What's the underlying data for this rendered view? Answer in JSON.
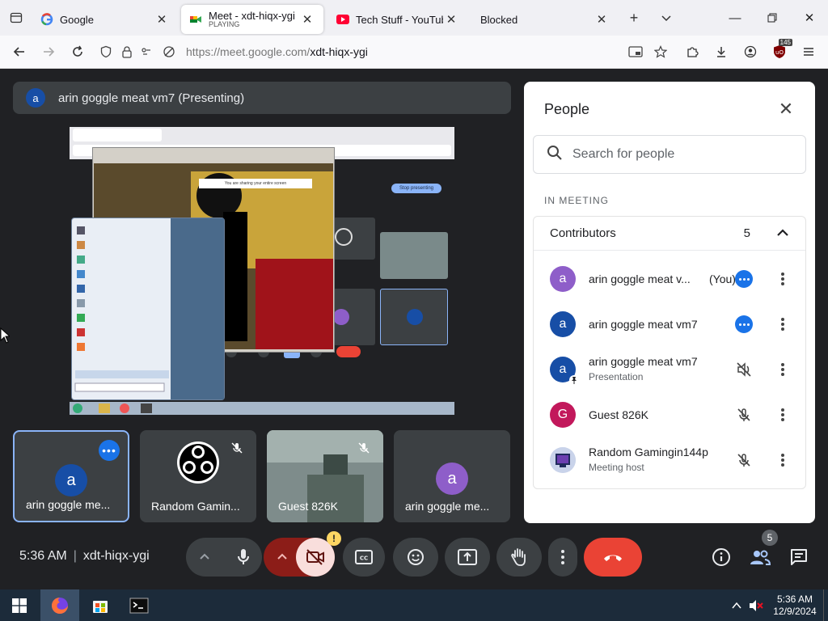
{
  "browser": {
    "tabs": [
      {
        "title": "Google",
        "subtitle": ""
      },
      {
        "title": "Meet - xdt-hiqx-ygi",
        "subtitle": "PLAYING"
      },
      {
        "title": "Tech Stuff - YouTube",
        "subtitle": ""
      },
      {
        "title": "Blocked",
        "subtitle": ""
      }
    ],
    "url_host": "https://meet.google.com/",
    "url_path": "xdt-hiqx-ygi",
    "extension_badge": "145"
  },
  "meet": {
    "presenting_avatar": "a",
    "presenting_label": "arin goggle meat vm7 (Presenting)",
    "tiles": [
      {
        "name": "arin goggle me...",
        "avatar": "a",
        "avatar_color": "#174ea6"
      },
      {
        "name": "Random Gamin...",
        "avatar": "",
        "avatar_color": "#000000"
      },
      {
        "name": "Guest 826K",
        "avatar": "",
        "avatar_color": ""
      },
      {
        "name": "arin goggle me...",
        "avatar": "a",
        "avatar_color": "#8e5ec9"
      }
    ],
    "time": "5:36 AM",
    "meeting_code": "xdt-hiqx-ygi",
    "people_count_badge": "5",
    "camera_warning": "!"
  },
  "people": {
    "title": "People",
    "search_placeholder": "Search for people",
    "section_label": "IN MEETING",
    "contributors_label": "Contributors",
    "contributors_count": "5",
    "rows": [
      {
        "avatar": "a",
        "color": "#8e5ec9",
        "name": "arin goggle meat v...",
        "suffix": "(You)",
        "sub": ""
      },
      {
        "avatar": "a",
        "color": "#174ea6",
        "name": "arin goggle meat vm7",
        "suffix": "",
        "sub": ""
      },
      {
        "avatar": "a",
        "color": "#174ea6",
        "name": "arin goggle meat vm7",
        "suffix": "",
        "sub": "Presentation"
      },
      {
        "avatar": "G",
        "color": "#c2185b",
        "name": "Guest 826K",
        "suffix": "",
        "sub": ""
      },
      {
        "avatar": "",
        "color": "#3c5a9a",
        "name": "Random Gamingin144p",
        "suffix": "",
        "sub": "Meeting host"
      }
    ]
  },
  "taskbar": {
    "time": "5:36 AM",
    "date": "12/9/2024"
  },
  "colors": {
    "meet_bg": "#202124",
    "accent_blue": "#1a73e8",
    "hangup_red": "#ea4335"
  }
}
